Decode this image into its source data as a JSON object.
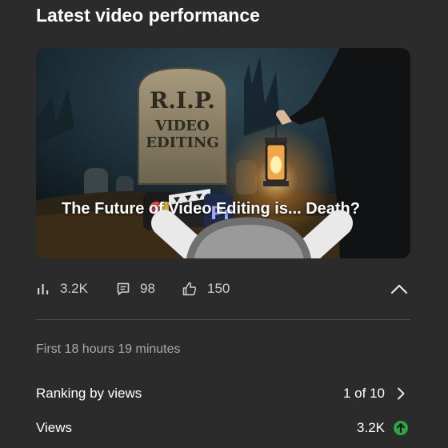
{
  "header": {
    "title": "Latest video performance"
  },
  "video": {
    "thumbnail_title": "The Future of Video Editing is... Death?",
    "thumbnail_emojis": [
      "skull-crossbones-icon",
      "headstone-icon"
    ],
    "tombstone_text": [
      "R.I.P.",
      "VIDEO",
      "EDITING"
    ]
  },
  "stats": {
    "views": "3.2K",
    "comments": "98",
    "likes": "150"
  },
  "period": "First 18 hours 19 minutes",
  "ranking": {
    "label": "Ranking by views",
    "value": "1 of 10"
  },
  "views_row": {
    "label": "Views",
    "value": "3.2K"
  },
  "colors": {
    "up_indicator": "#2ba640",
    "background": "#2b2b2b",
    "muted_text": "#a9a9a9"
  }
}
